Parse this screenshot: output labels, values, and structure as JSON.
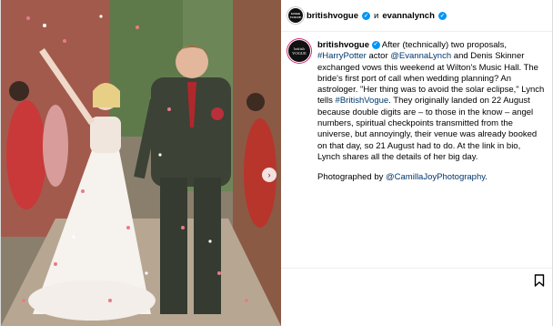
{
  "header": {
    "account": "britishvogue",
    "conjunction": "и",
    "coauthor": "evannalynch",
    "avatar_text": "british VOGUE"
  },
  "caption": {
    "user": "britishvogue",
    "t1": " After (technically) two proposals, ",
    "l1": "#HarryPotter",
    "t2": " actor ",
    "l2": "@EvannaLynch",
    "t3": " and Denis Skinner exchanged vows this weekend at Wilton's Music Hall. The bride's first port of call when wedding planning? An astrologer. \"Her thing was to avoid the solar eclipse,\" Lynch tells ",
    "l3": "#BritishVogue",
    "t4": ". They originally landed on 22 August because double digits are – to those in the know – angel numbers, spiritual checkpoints transmitted from the universe, but annoyingly, their venue was already booked on that day, so 21 August had to do. At the link in bio, Lynch shares all the details of her big day.",
    "credit_prefix": "Photographed by ",
    "credit_link": "@CamillaJoyPhotography",
    "credit_suffix": "."
  },
  "icons": {
    "verified": "verified-badge-icon",
    "next": "chevron-right-icon",
    "save": "bookmark-icon"
  },
  "colors": {
    "link": "#00376b",
    "verified": "#0095f6",
    "border": "#dbdbdb"
  }
}
